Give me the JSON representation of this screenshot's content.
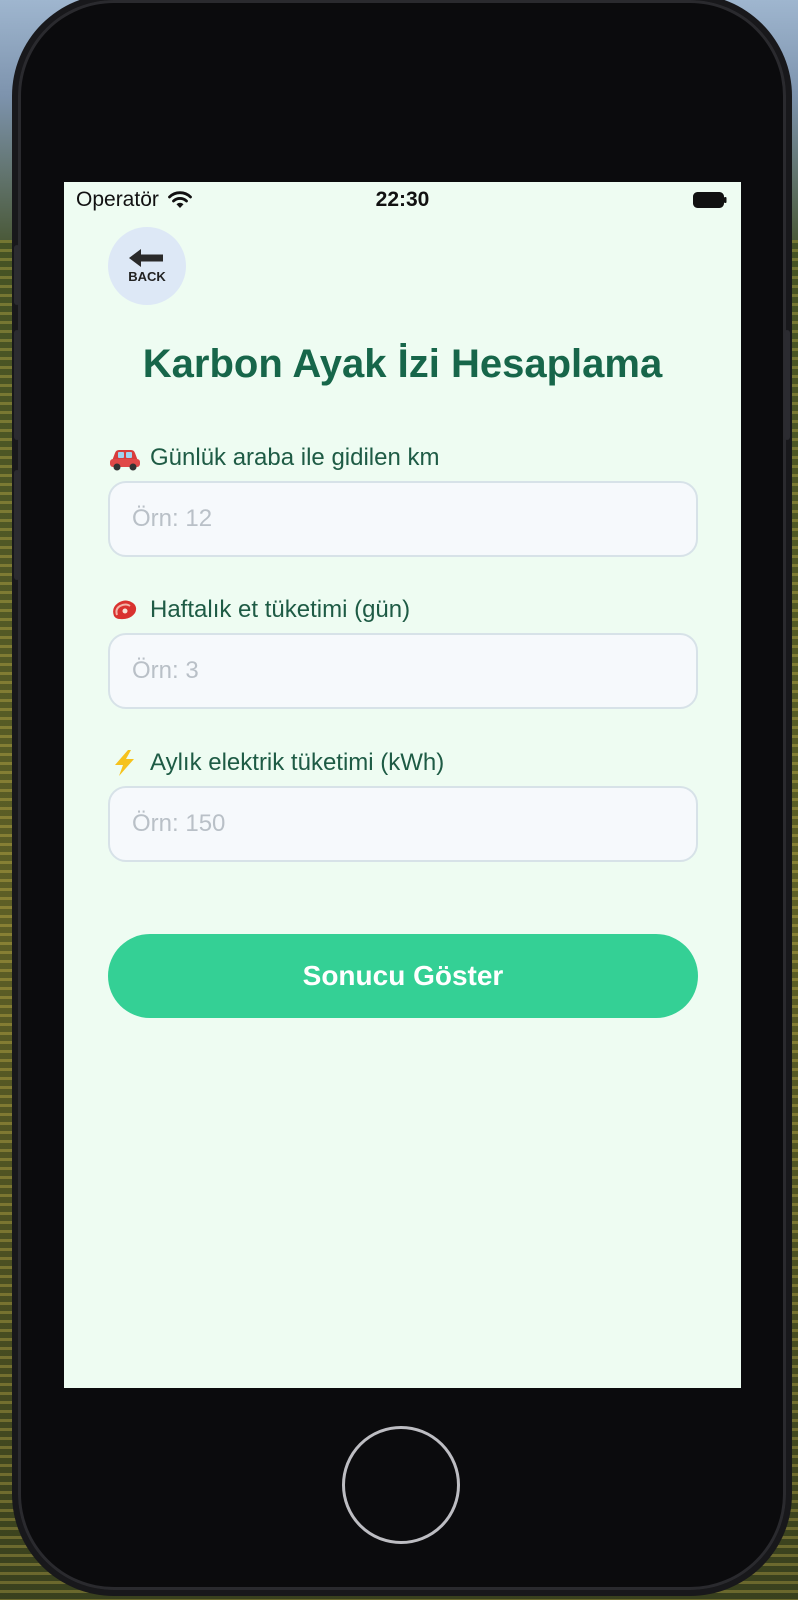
{
  "status_bar": {
    "carrier": "Operatör",
    "time": "22:30"
  },
  "back_button": {
    "label": "BACK"
  },
  "page": {
    "title": "Karbon Ayak İzi Hesaplama"
  },
  "fields": [
    {
      "icon": "car-icon",
      "label": "Günlük araba ile gidilen km",
      "placeholder": "Örn: 12",
      "value": ""
    },
    {
      "icon": "meat-icon",
      "label": "Haftalık et tüketimi (gün)",
      "placeholder": "Örn: 3",
      "value": ""
    },
    {
      "icon": "lightning-icon",
      "label": "Aylık elektrik tüketimi (kWh)",
      "placeholder": "Örn: 150",
      "value": ""
    }
  ],
  "submit": {
    "label": "Sonucu Göster"
  },
  "colors": {
    "accent": "#34d095",
    "title": "#17664a",
    "label": "#1e5b45",
    "screen_bg": "#eefcf2"
  }
}
